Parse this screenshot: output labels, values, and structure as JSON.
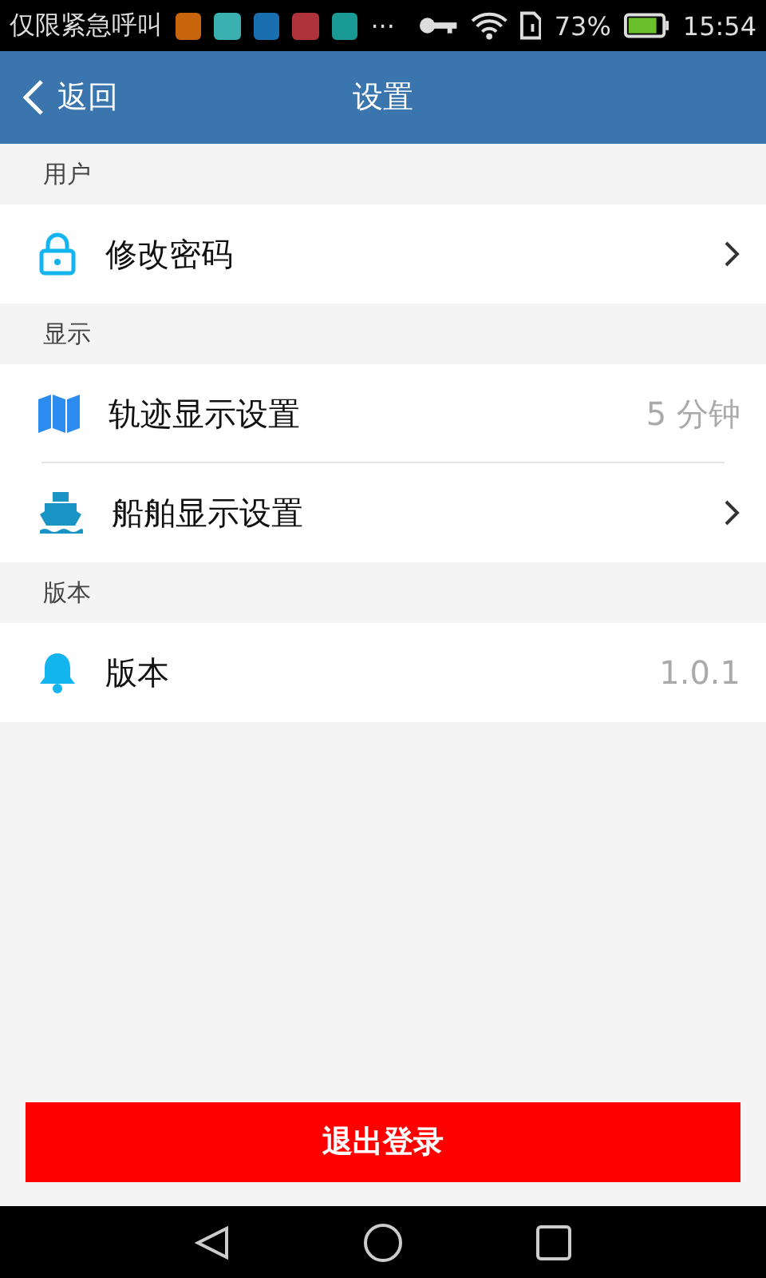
{
  "status_bar": {
    "carrier": "仅限紧急呼叫",
    "app_icons": [
      {
        "color": "#c8650c"
      },
      {
        "color": "#3ab0b0"
      },
      {
        "color": "#1a6fb0"
      },
      {
        "color": "#b0323a"
      },
      {
        "color": "#1a9a94"
      }
    ],
    "overflow": "···",
    "battery_text": "73%",
    "time": "15:54"
  },
  "header": {
    "back": "返回",
    "title": "设置"
  },
  "sections": [
    {
      "title": "用户",
      "rows": [
        {
          "label": "修改密码",
          "kind": "link"
        }
      ]
    },
    {
      "title": "显示",
      "rows": [
        {
          "label": "轨迹显示设置",
          "kind": "value",
          "value": "5 分钟"
        },
        {
          "label": "船舶显示设置",
          "kind": "link"
        }
      ]
    },
    {
      "title": "版本",
      "rows": [
        {
          "label": "版本",
          "kind": "value",
          "value": "1.0.1"
        }
      ]
    }
  ],
  "logout_button": "退出登录"
}
